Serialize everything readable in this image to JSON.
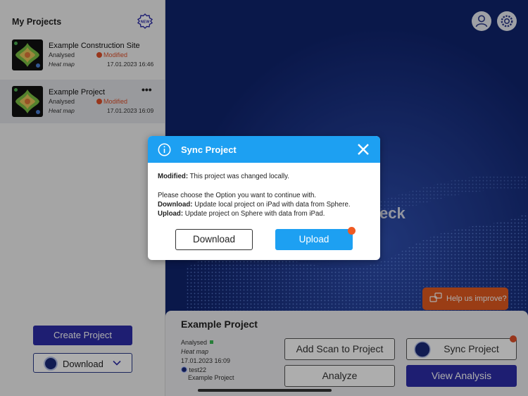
{
  "sidebar": {
    "title": "My Projects",
    "new_badge": "NEW",
    "projects": [
      {
        "name": "Example Construction Site",
        "status": "Analysed",
        "modified": "Modified",
        "type": "Heat map",
        "date": "17.01.2023 16:46"
      },
      {
        "name": "Example Project",
        "status": "Analysed",
        "modified": "Modified",
        "type": "Heat map",
        "date": "17.01.2023 16:09",
        "more": "•••"
      }
    ],
    "create_label": "Create Project",
    "download_label": "Download"
  },
  "main": {
    "brand_fragment": "eck",
    "help_label": "Help us improve?"
  },
  "detail": {
    "title": "Example Project",
    "status": "Analysed",
    "type": "Heat map",
    "date": "17.01.2023 16:09",
    "scan_name": "test22",
    "scan_project": "Example Project",
    "add_scan_label": "Add Scan to Project",
    "sync_label": "Sync Project",
    "analyze_label": "Analyze",
    "view_analysis_label": "View Analysis"
  },
  "dialog": {
    "title": "Sync Project",
    "modified_key": "Modified:",
    "modified_text": " This project was changed locally.",
    "choose_text": "Please choose the Option you want to continue with.",
    "download_key": "Download:",
    "download_text": " Update local project on iPad with data from Sphere.",
    "upload_key": "Upload:",
    "upload_text": " Update project on Sphere with data from iPad.",
    "download_button": "Download",
    "upload_button": "Upload"
  },
  "colors": {
    "accent_blue": "#1da0f2",
    "primary_navy": "#2d2da8",
    "alert_orange": "#e35a1f",
    "modified_red": "#e0502a",
    "background_navy": "#10246e"
  }
}
